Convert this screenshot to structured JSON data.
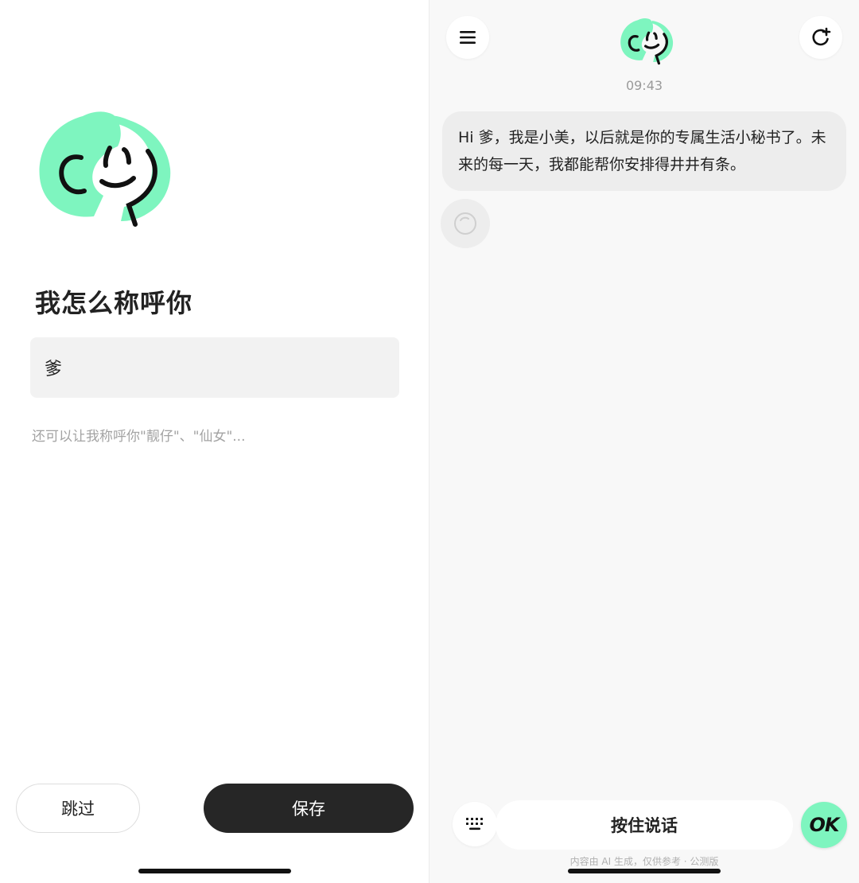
{
  "setup": {
    "title": "我怎么称呼你",
    "name_value": "爹",
    "hint": "还可以让我称呼你\"靓仔\"、\"仙女\"...",
    "skip_label": "跳过",
    "save_label": "保存"
  },
  "chat": {
    "time": "09:43",
    "message": "Hi 爹，我是小美，以后就是你的专属生活小秘书了。未来的每一天，我都能帮你安排得井井有条。",
    "talk_label": "按住说话",
    "ok_badge": "OK",
    "disclaimer": "内容由 AI 生成，仅供参考 · 公测版",
    "icons": {
      "menu": "menu-icon",
      "new_chat": "new-chat-icon",
      "keyboard": "keyboard-icon",
      "loading": "loading-spinner-icon"
    }
  },
  "colors": {
    "accent_mint": "#7ef5bf",
    "dark_button": "#262626",
    "input_bg": "#f2f2f2",
    "bubble_bg": "#ededed"
  }
}
